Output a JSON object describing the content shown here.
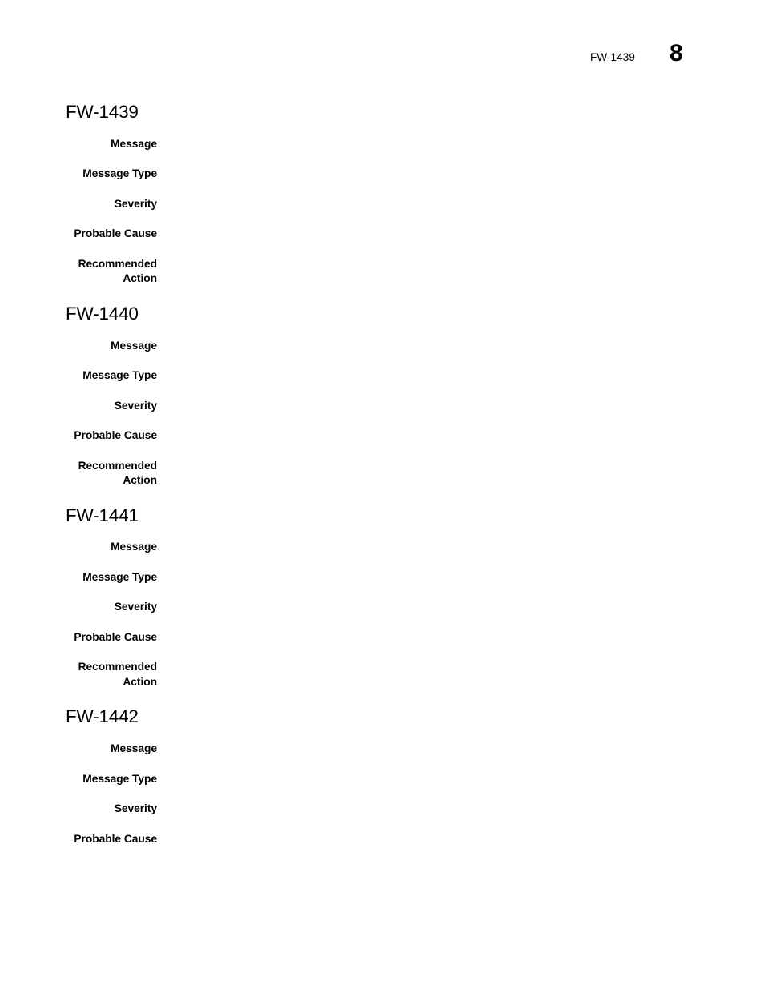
{
  "header": {
    "running_ref": "FW-1439",
    "page_number": "8"
  },
  "sections": [
    {
      "title": "FW-1439",
      "rows": [
        {
          "label": "Message",
          "value": ""
        },
        {
          "label": "Message Type",
          "value": ""
        },
        {
          "label": "Severity",
          "value": ""
        },
        {
          "label": "Probable Cause",
          "value": ""
        },
        {
          "label": "Recommended\nAction",
          "value": ""
        }
      ]
    },
    {
      "title": "FW-1440",
      "rows": [
        {
          "label": "Message",
          "value": ""
        },
        {
          "label": "Message Type",
          "value": ""
        },
        {
          "label": "Severity",
          "value": ""
        },
        {
          "label": "Probable Cause",
          "value": ""
        },
        {
          "label": "Recommended\nAction",
          "value": ""
        }
      ]
    },
    {
      "title": "FW-1441",
      "rows": [
        {
          "label": "Message",
          "value": ""
        },
        {
          "label": "Message Type",
          "value": ""
        },
        {
          "label": "Severity",
          "value": ""
        },
        {
          "label": "Probable Cause",
          "value": ""
        },
        {
          "label": "Recommended\nAction",
          "value": ""
        }
      ]
    },
    {
      "title": "FW-1442",
      "rows": [
        {
          "label": "Message",
          "value": ""
        },
        {
          "label": "Message Type",
          "value": ""
        },
        {
          "label": "Severity",
          "value": ""
        },
        {
          "label": "Probable Cause",
          "value": ""
        }
      ]
    }
  ]
}
